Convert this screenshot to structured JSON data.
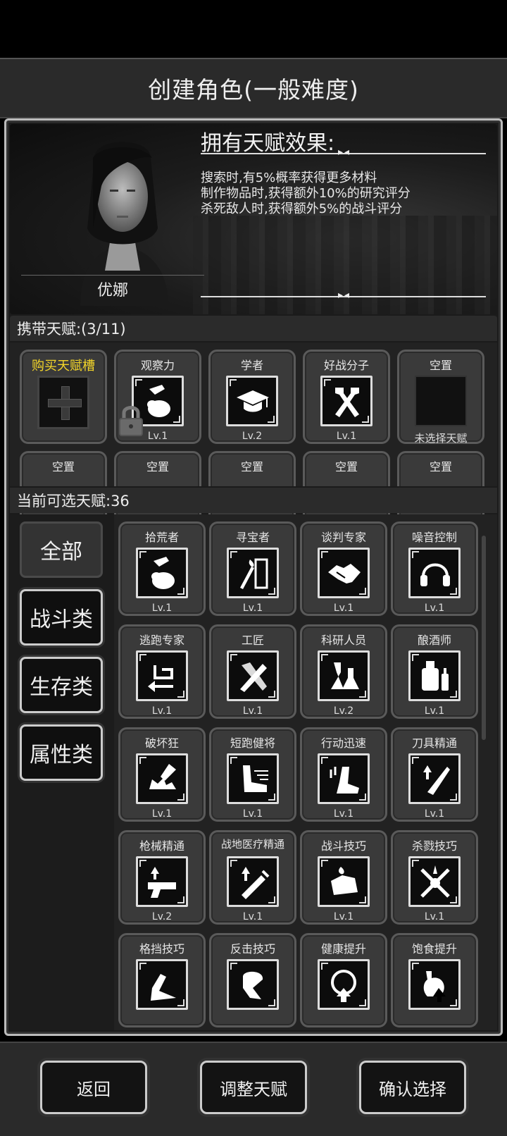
{
  "header": {
    "title": "创建角色(一般难度)"
  },
  "character": {
    "name": "优娜",
    "effects_title": "拥有天赋效果:",
    "effects": [
      "搜索时,有5%概率获得更多材料",
      "制作物品时,获得额外10%的研究评分",
      "杀死敌人时,获得额外5%的战斗评分"
    ]
  },
  "carried": {
    "heading": "携带天赋:(3/11)",
    "buy_label": "购买天赋槽",
    "slots": [
      {
        "name": "观察力",
        "level": "Lv.1",
        "icon": "hand-bag-icon",
        "locked": true
      },
      {
        "name": "学者",
        "level": "Lv.2",
        "icon": "graduation-cap-icon"
      },
      {
        "name": "好战分子",
        "level": "Lv.1",
        "icon": "crossed-hammers-icon"
      },
      {
        "name": "空置",
        "note": "未选择天赋"
      }
    ],
    "row2": [
      "空置",
      "空置",
      "空置",
      "空置",
      "空置"
    ]
  },
  "available": {
    "heading": "当前可选天赋:36",
    "categories": [
      "全部",
      "战斗类",
      "生存类",
      "属性类"
    ],
    "talents": [
      {
        "name": "拾荒者",
        "level": "Lv.1",
        "icon": "hand-bag-icon"
      },
      {
        "name": "寻宝者",
        "level": "Lv.1",
        "icon": "torch-door-icon"
      },
      {
        "name": "谈判专家",
        "level": "Lv.1",
        "icon": "handshake-icon"
      },
      {
        "name": "噪音控制",
        "level": "Lv.1",
        "icon": "headphones-icon"
      },
      {
        "name": "逃跑专家",
        "level": "Lv.1",
        "icon": "return-arrow-icon"
      },
      {
        "name": "工匠",
        "level": "Lv.1",
        "icon": "hammer-saw-icon"
      },
      {
        "name": "科研人员",
        "level": "Lv.2",
        "icon": "flask-icon"
      },
      {
        "name": "酿酒师",
        "level": "Lv.1",
        "icon": "brewing-icon"
      },
      {
        "name": "破坏狂",
        "level": "Lv.1",
        "icon": "smash-icon"
      },
      {
        "name": "短跑健将",
        "level": "Lv.1",
        "icon": "sprint-leg-icon"
      },
      {
        "name": "行动迅速",
        "level": "Lv.1",
        "icon": "fast-move-icon"
      },
      {
        "name": "刀具精通",
        "level": "Lv.1",
        "icon": "blade-icon"
      },
      {
        "name": "枪械精通",
        "level": "Lv.2",
        "icon": "pistol-icon"
      },
      {
        "name": "战地医疗精通",
        "level": "Lv.1",
        "icon": "syringe-icon"
      },
      {
        "name": "战斗技巧",
        "level": "Lv.1",
        "icon": "fist-icon"
      },
      {
        "name": "杀戮技巧",
        "level": "Lv.1",
        "icon": "crossed-swords-icon"
      },
      {
        "name": "格挡技巧",
        "level": "",
        "icon": "block-icon"
      },
      {
        "name": "反击技巧",
        "level": "",
        "icon": "counter-icon"
      },
      {
        "name": "健康提升",
        "level": "",
        "icon": "health-up-icon"
      },
      {
        "name": "饱食提升",
        "level": "",
        "icon": "stomach-up-icon"
      }
    ]
  },
  "footer": {
    "back": "返回",
    "adjust": "调整天赋",
    "confirm": "确认选择"
  }
}
